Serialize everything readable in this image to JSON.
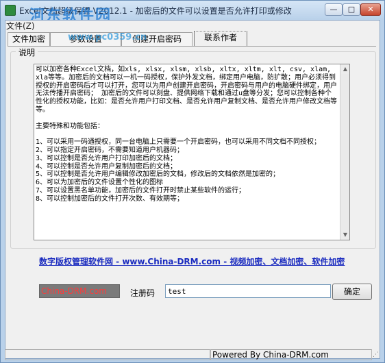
{
  "window": {
    "title": "Excel文档超级保镖 V2012.1 - 加密后的文件可以设置是否允许打印或修改",
    "watermark": "河东软件园",
    "watermark_url": "www.pc0359.cn",
    "controls": {
      "minimize": "—",
      "maximize": "□",
      "close": "✕"
    },
    "icon": "app-icon"
  },
  "menu_text": "文件(Z)",
  "tabs": [
    {
      "label": "文件加密",
      "active": false
    },
    {
      "label": "参数设置",
      "active": false
    },
    {
      "label": "创建开启密码",
      "active": false
    },
    {
      "label": "联系作者",
      "active": true
    }
  ],
  "group_label": "说明",
  "description": "可以加密各种Excel文档，如xls, xlsx, xlsm, xlsb, xltx, xltm, xlt, csv, xlam, xla等等。加密后的文档可以一机一码授权，保护外发文档，绑定用户电脑，防扩散；用户必须得到授权的开启密码后才可以打开，您可以为用户创建开启密码，开启密码与用户的电脑硬件绑定，用户无法传播开启密码； 加密后的文件可以刻盘、提供网络下载和通过u盘等分发；您可以控制各种个性化的授权功能，比如：是否允许用户打印文档、是否允许用户复制文档、是否允许用户修改文档等等。\n\n主要特殊和功能包括：\n\n1、可以采用一码通授权，同一台电脑上只需要一个开启密码，也可以采用不同文档不同授权；\n2、可以指定开启密码，不需要知道用户机器码；\n3、可以控制是否允许用户打印加密后的文档；\n4、可以控制是否允许用户复制加密后的文档；\n5、可以控制是否允许用户编辑修改加密后的文档，修改后的文档依然是加密的；\n6、可以为加密后的文件设置个性化的图标\n7、可以设置黑名单功能，加密后的文件打开时禁止某些软件的运行；\n8、可以控制加密后的文件打开次数、有效期等；",
  "link_text": "数字版权管理软件网 - www.China-DRM.com - 视频加密、文档加密、软件加密",
  "code_box_text": "China-DRM.com",
  "register": {
    "label": "注册码",
    "value": "test",
    "button": "确定"
  },
  "status": {
    "right": "Powered By China-DRM.com"
  },
  "colors": {
    "title_gradient": "#b9d1ea",
    "link": "#1a2bbf",
    "code_box_bg": "#7a7a7a",
    "code_box_text": "#ff3b3b"
  }
}
